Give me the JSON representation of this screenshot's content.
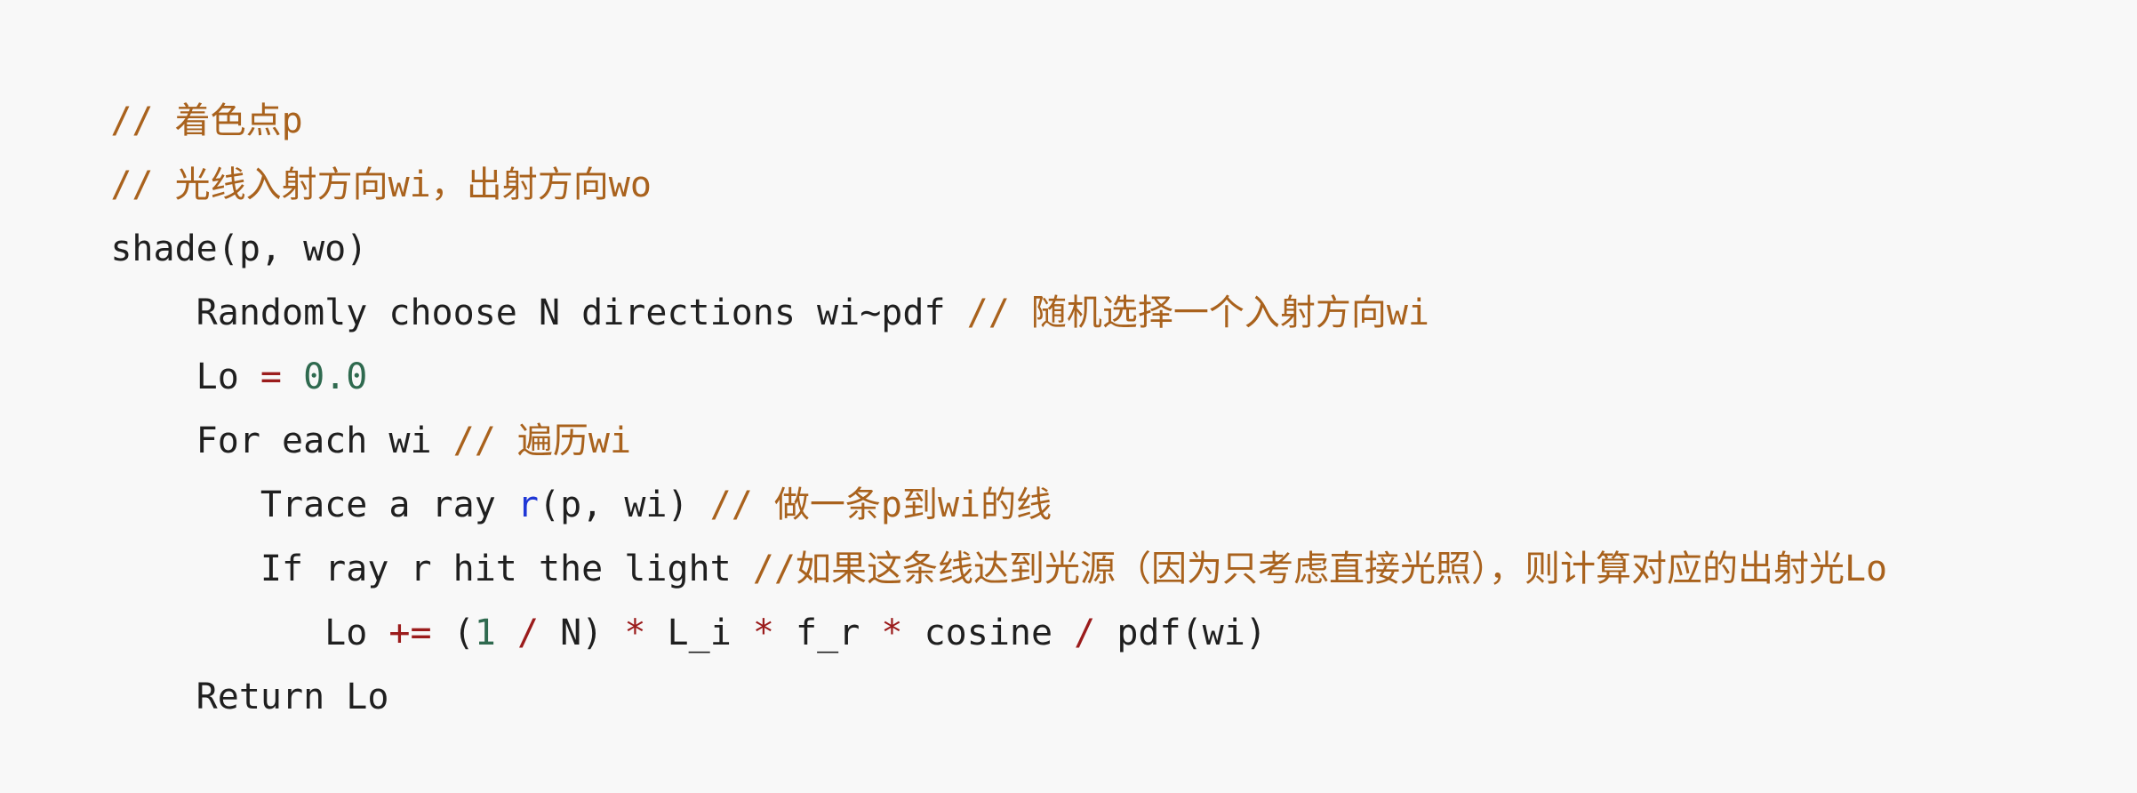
{
  "code": {
    "lines": [
      [
        {
          "cls": "tok-comment",
          "text": "// 着色点p"
        }
      ],
      [
        {
          "cls": "tok-comment",
          "text": "// 光线入射方向wi，出射方向wo"
        }
      ],
      [
        {
          "cls": "tok-plain",
          "text": "shade(p, wo)"
        }
      ],
      [
        {
          "cls": "tok-plain",
          "text": "    Randomly choose N directions wi~pdf "
        },
        {
          "cls": "tok-comment",
          "text": "// 随机选择一个入射方向wi"
        }
      ],
      [
        {
          "cls": "tok-plain",
          "text": "    Lo "
        },
        {
          "cls": "tok-op",
          "text": "="
        },
        {
          "cls": "tok-plain",
          "text": " "
        },
        {
          "cls": "tok-num",
          "text": "0.0"
        }
      ],
      [
        {
          "cls": "tok-plain",
          "text": "    For each wi "
        },
        {
          "cls": "tok-comment",
          "text": "// 遍历wi"
        }
      ],
      [
        {
          "cls": "tok-plain",
          "text": "       Trace a ray "
        },
        {
          "cls": "tok-fn",
          "text": "r"
        },
        {
          "cls": "tok-plain",
          "text": "(p, wi) "
        },
        {
          "cls": "tok-comment",
          "text": "// 做一条p到wi的线"
        }
      ],
      [
        {
          "cls": "tok-plain",
          "text": "       If ray r hit the light "
        },
        {
          "cls": "tok-comment",
          "text": "//如果这条线达到光源（因为只考虑直接光照），则计算对应的出射光Lo"
        }
      ],
      [
        {
          "cls": "tok-plain",
          "text": "          Lo "
        },
        {
          "cls": "tok-op",
          "text": "+="
        },
        {
          "cls": "tok-plain",
          "text": " ("
        },
        {
          "cls": "tok-num",
          "text": "1"
        },
        {
          "cls": "tok-plain",
          "text": " "
        },
        {
          "cls": "tok-op",
          "text": "/"
        },
        {
          "cls": "tok-plain",
          "text": " N) "
        },
        {
          "cls": "tok-op",
          "text": "*"
        },
        {
          "cls": "tok-plain",
          "text": " L_i "
        },
        {
          "cls": "tok-op",
          "text": "*"
        },
        {
          "cls": "tok-plain",
          "text": " f_r "
        },
        {
          "cls": "tok-op",
          "text": "*"
        },
        {
          "cls": "tok-plain",
          "text": " cosine "
        },
        {
          "cls": "tok-op",
          "text": "/"
        },
        {
          "cls": "tok-plain",
          "text": " pdf(wi)"
        }
      ],
      [
        {
          "cls": "tok-plain",
          "text": "    Return Lo"
        }
      ]
    ]
  }
}
